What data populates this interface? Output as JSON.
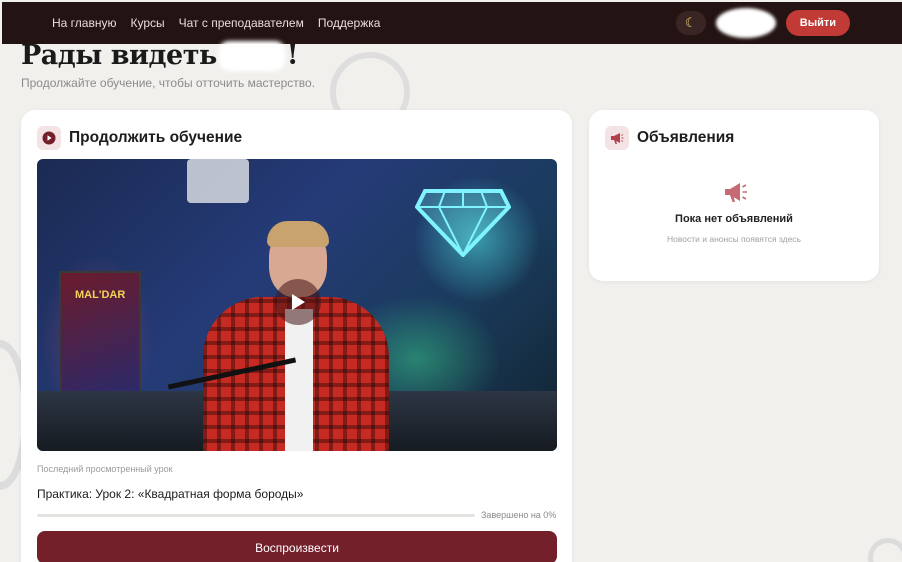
{
  "nav": {
    "items": [
      {
        "label": "На главную"
      },
      {
        "label": "Курсы"
      },
      {
        "label": "Чат с преподавателем"
      },
      {
        "label": "Поддержка"
      }
    ]
  },
  "header": {
    "theme_icon": "moon-icon",
    "logout_label": "Выйти"
  },
  "greeting": {
    "text_before": "Рады видеть",
    "text_after": "!",
    "subtitle": "Продолжайте обучение, чтобы отточить мастерство."
  },
  "continue_card": {
    "title": "Продолжить обучение",
    "icon": "play-circle-icon",
    "video": {
      "poster_text": "MAL'DAR",
      "play_icon": "play-icon"
    },
    "last_label": "Последний просмотренный урок",
    "lesson_title": "Практика: Урок 2: «Квадратная форма бороды»",
    "progress_percent": 0,
    "progress_text": "Завершено на 0%",
    "cta_label": "Воспроизвести"
  },
  "announcements_card": {
    "title": "Объявления",
    "icon": "megaphone-icon",
    "empty_title": "Пока нет объявлений",
    "empty_subtitle": "Новости и анонсы появятся здесь"
  },
  "colors": {
    "topbar": "#241313",
    "accent": "#74202b",
    "logout": "#c23a36",
    "background": "#f2f0ed"
  }
}
